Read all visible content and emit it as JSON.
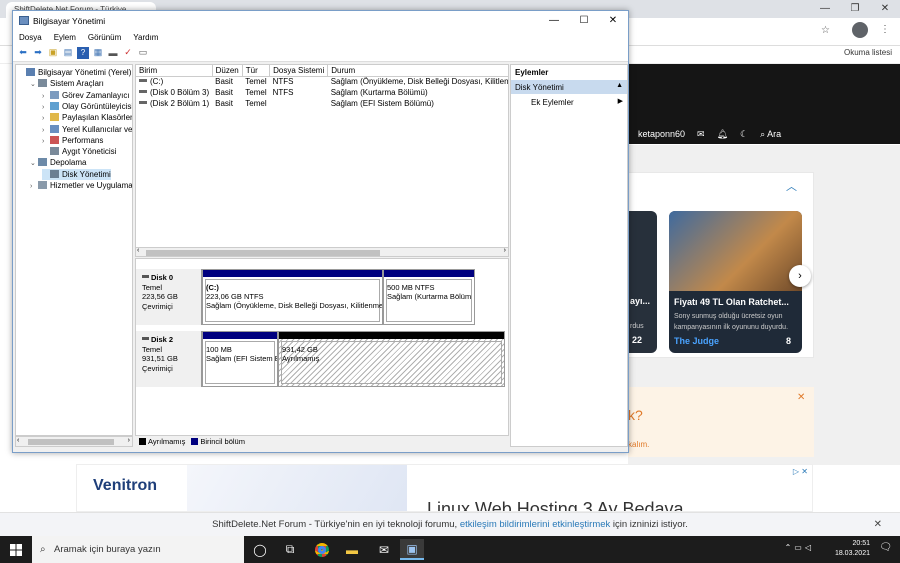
{
  "browser": {
    "tab_title": "ShiftDelete.Net Forum - Türkiye",
    "reading_list": "Okuma listesi",
    "window_controls": {
      "minimize": "—",
      "restore": "❐",
      "close": "✕"
    }
  },
  "site": {
    "username": "ketaponn60",
    "search_label": "Ara",
    "card_left": {
      "title": "ayı...",
      "meta": "rdus",
      "count": "22"
    },
    "card_right": {
      "title": "Fiyatı 49 TL Olan Ratchet...",
      "desc": "Sony sunmuş olduğu ücretsiz oyun kampanyasının ilk oyununu duyurdu.",
      "author": "The Judge",
      "count": "8"
    },
    "promo_title": "k?",
    "promo_text": "kalım.",
    "ad": {
      "logo": "Venitron",
      "text": "Linux Web Hosting 3 Ay Bedava"
    },
    "notification": {
      "prefix": "ShiftDelete.Net Forum - Türkiye'nin en iyi teknoloji forumu,",
      "link": "etkileşim bildirimlerini etkinleştirmek",
      "suffix": "için izninizi istiyor."
    }
  },
  "window": {
    "title": "Bilgisayar Yönetimi",
    "menu": [
      "Dosya",
      "Eylem",
      "Görünüm",
      "Yardım"
    ],
    "tree": [
      {
        "label": "Bilgisayar Yönetimi (Yerel)",
        "level": 0,
        "expander": "",
        "selected": false
      },
      {
        "label": "Sistem Araçları",
        "level": 1,
        "expander": "⌄",
        "selected": false
      },
      {
        "label": "Görev Zamanlayıcı",
        "level": 2,
        "expander": "›",
        "selected": false
      },
      {
        "label": "Olay Görüntüleyicisi",
        "level": 2,
        "expander": "›",
        "selected": false
      },
      {
        "label": "Paylaşılan Klasörler",
        "level": 2,
        "expander": "›",
        "selected": false
      },
      {
        "label": "Yerel Kullanıcılar ve Gru",
        "level": 2,
        "expander": "›",
        "selected": false
      },
      {
        "label": "Performans",
        "level": 2,
        "expander": "›",
        "selected": false
      },
      {
        "label": "Aygıt Yöneticisi",
        "level": 2,
        "expander": "",
        "selected": false
      },
      {
        "label": "Depolama",
        "level": 1,
        "expander": "⌄",
        "selected": false
      },
      {
        "label": "Disk Yönetimi",
        "level": 2,
        "expander": "",
        "selected": true
      },
      {
        "label": "Hizmetler ve Uygulamalar",
        "level": 1,
        "expander": "›",
        "selected": false
      }
    ],
    "columns": [
      "Birim",
      "Düzen",
      "Tür",
      "Dosya Sistemi",
      "Durum"
    ],
    "volumes": [
      [
        "(C:)",
        "Basit",
        "Temel",
        "NTFS",
        "Sağlam (Önyükleme, Disk Belleği Dosyası, Kilitlenme Bilgis"
      ],
      [
        "(Disk 0 Bölüm 3)",
        "Basit",
        "Temel",
        "NTFS",
        "Sağlam (Kurtarma Bölümü)"
      ],
      [
        "(Disk 2 Bölüm 1)",
        "Basit",
        "Temel",
        "",
        "Sağlam (EFI Sistem Bölümü)"
      ]
    ],
    "disks": [
      {
        "name": "Disk 0",
        "type": "Temel",
        "size": "223,56 GB",
        "status": "Çevrimiçi",
        "partitions": [
          {
            "name": "(C:)",
            "size": "223,06 GB NTFS",
            "status": "Sağlam (Önyükleme, Disk Belleği Dosyası, Kilitlenme",
            "kind": "primary"
          },
          {
            "name": "",
            "size": "500 MB NTFS",
            "status": "Sağlam (Kurtarma Bölüm",
            "kind": "primary"
          }
        ]
      },
      {
        "name": "Disk 2",
        "type": "Temel",
        "size": "931,51 GB",
        "status": "Çevrimiçi",
        "partitions": [
          {
            "name": "",
            "size": "100 MB",
            "status": "Sağlam (EFI Sistem B",
            "kind": "primary"
          },
          {
            "name": "",
            "size": "931,42 GB",
            "status": "Ayrılmamış",
            "kind": "unallocated"
          }
        ]
      }
    ],
    "legend": {
      "unallocated": "Ayrılmamış",
      "primary": "Birincil bölüm"
    },
    "actions": {
      "header": "Eylemler",
      "selected": "Disk Yönetimi",
      "more": "Ek Eylemler"
    }
  },
  "taskbar": {
    "search_placeholder": "Aramak için buraya yazın",
    "time": "20:51",
    "date": "18.03.2021"
  },
  "colors": {
    "primary_partition": "#00007f",
    "selected_action": "#c8daee",
    "link": "#2a7ab8",
    "accent_orange": "#e07a2a"
  }
}
